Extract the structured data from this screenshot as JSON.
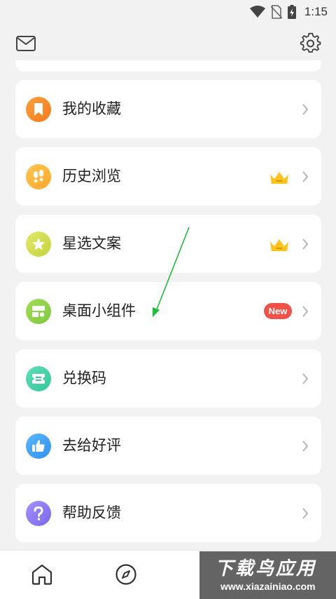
{
  "status_bar": {
    "time": "1:15"
  },
  "top_bar": {
    "mail_icon": "mail-icon",
    "settings_icon": "gear-icon"
  },
  "menu": {
    "items": [
      {
        "label": "我的收藏",
        "icon": "bookmark-icon",
        "color": "#ff8c2e"
      },
      {
        "label": "历史浏览",
        "icon": "footprint-icon",
        "color": "#ffb73a",
        "vip": true
      },
      {
        "label": "星选文案",
        "icon": "star-icon",
        "color": "#cbd84a",
        "vip": true
      },
      {
        "label": "桌面小组件",
        "icon": "widget-icon",
        "color": "#8fd24c",
        "badge": "New"
      },
      {
        "label": "兑换码",
        "icon": "ticket-icon",
        "color": "#46d4a8"
      },
      {
        "label": "去给好评",
        "icon": "thumbs-up-icon",
        "color": "#3fa6f5"
      },
      {
        "label": "帮助反馈",
        "icon": "question-icon",
        "color": "#8f7bf2"
      }
    ]
  },
  "tab_bar": {
    "items": [
      "home-icon",
      "compass-icon"
    ]
  },
  "watermark": {
    "title": "下载鸟应用",
    "url": "www.xiazainiao.com"
  },
  "colors": {
    "accent_new": "#f15146",
    "crown": "#ffc21a",
    "background": "#f2f2f2"
  }
}
